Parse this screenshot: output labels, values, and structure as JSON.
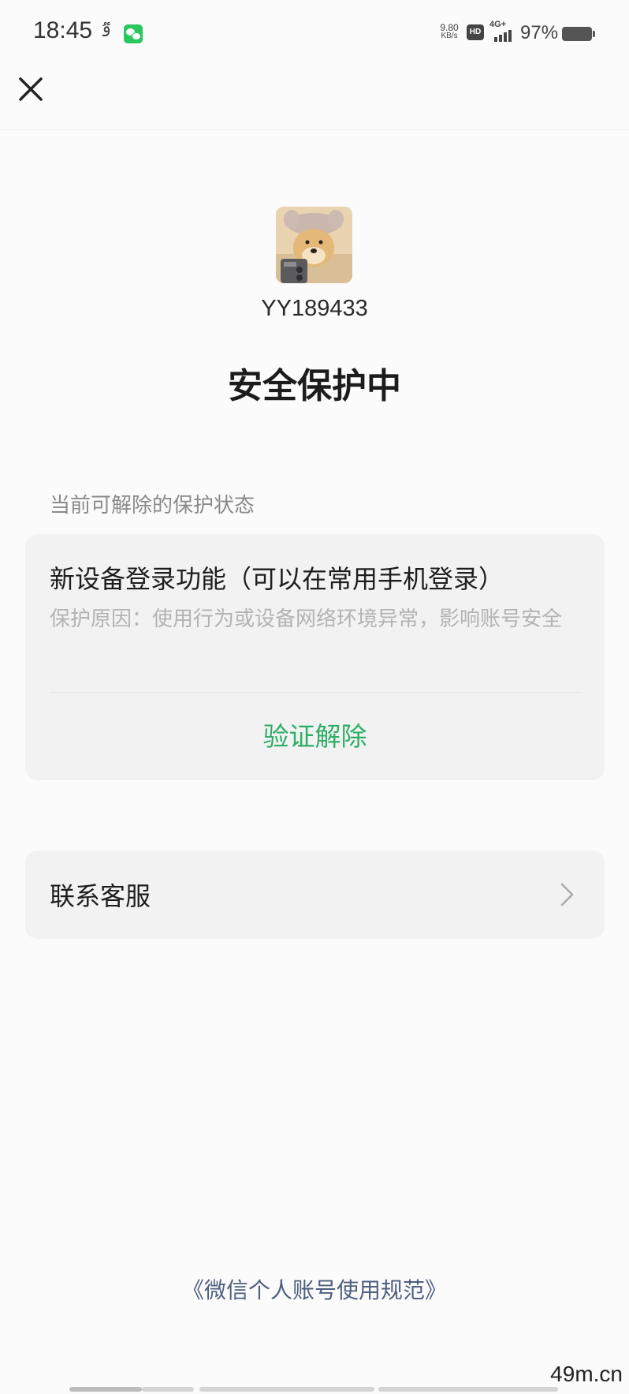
{
  "status_bar": {
    "time": "18:45",
    "app_glyph": "ٷ",
    "net_speed_value": "9.80",
    "net_speed_unit": "KB/s",
    "hd_label": "HD",
    "network_label": "4G+",
    "battery": "97%"
  },
  "header": {
    "close_icon": "close-icon"
  },
  "profile": {
    "username": "YY189433"
  },
  "page_title": "安全保护中",
  "section_label": "当前可解除的保护状态",
  "protection": {
    "title": "新设备登录功能（可以在常用手机登录）",
    "reason": "保护原因：使用行为或设备网络环境异常，影响账号安全",
    "action_label": "验证解除",
    "accent_color": "#2fae67"
  },
  "contact": {
    "label": "联系客服"
  },
  "footer": {
    "terms": "《微信个人账号使用规范》"
  },
  "watermark": "49m.cn"
}
